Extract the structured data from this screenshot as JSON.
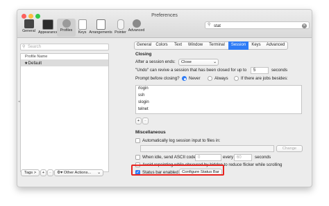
{
  "window": {
    "title": "Preferences"
  },
  "toolbar": {
    "items": [
      {
        "label": "General",
        "icon": "general-icon"
      },
      {
        "label": "Appearance",
        "icon": "appearance-icon"
      },
      {
        "label": "Profiles",
        "icon": "profiles-icon",
        "selected": true
      },
      {
        "label": "Keys",
        "icon": "keys-icon"
      },
      {
        "label": "Arrangements",
        "icon": "arrangements-icon"
      },
      {
        "label": "Pointer",
        "icon": "pointer-icon"
      },
      {
        "label": "Advanced",
        "icon": "advanced-icon"
      }
    ],
    "search_value": "stat"
  },
  "sidebar": {
    "search_placeholder": "Search",
    "column_header": "Profile Name",
    "profiles": [
      {
        "name": "★Default",
        "selected": true
      }
    ],
    "tags_button": "Tags >",
    "add_button": "+",
    "remove_button": "−",
    "other_actions": "Other Actions..."
  },
  "tabs": [
    {
      "label": "General"
    },
    {
      "label": "Colors"
    },
    {
      "label": "Text"
    },
    {
      "label": "Window"
    },
    {
      "label": "Terminal"
    },
    {
      "label": "Session",
      "active": true
    },
    {
      "label": "Keys"
    },
    {
      "label": "Advanced"
    }
  ],
  "closing": {
    "title": "Closing",
    "after_session_label": "After a session ends:",
    "after_session_value": "Close",
    "undo_label_pre": "\"Undo\" can revive a session that has been closed for up to",
    "undo_value": "5",
    "undo_label_post": "seconds",
    "prompt_label": "Prompt before closing?",
    "options": [
      "Never",
      "Always",
      "If there are jobs besides:"
    ],
    "selected_option": "Never",
    "commands": [
      "rlogin",
      "ssh",
      "slogin",
      "telnet"
    ],
    "add": "+",
    "remove": "−"
  },
  "misc": {
    "title": "Miscellaneous",
    "auto_log_label": "Automatically log session input to files in:",
    "change_button": "Change",
    "idle_label": "When idle, send ASCII code",
    "idle_code": "0",
    "every_label": "every",
    "every_value": "60",
    "seconds_label": "seconds",
    "obscured_label": "Avoid repainting while obscured by hidden to reduce flicker while scrolling",
    "status_bar_label": "Status bar enabled",
    "status_bar_checked": true,
    "configure_button": "Configure Status Bar"
  },
  "colors": {
    "accent": "#2f7cf6",
    "highlight": "#e8231f"
  }
}
